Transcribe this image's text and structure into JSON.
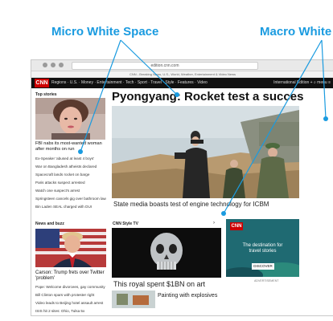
{
  "annotations": {
    "micro": "Micro White Space",
    "macro": "Macro White"
  },
  "browser": {
    "url": "edition.cnn.com",
    "tab_title": "CNN - Breaking News, U.S., World, Weather, Entertainment & Video News"
  },
  "nav": {
    "logo": "CNN",
    "links": "Regions · U.S. · Money · Entertainment · Tech · Sport · Travel · Style · Features · Video",
    "edition": "International Edition +",
    "menu": "menu"
  },
  "top_stories": {
    "label": "Top stories",
    "headline": "FBI nabs its most-wanted woman after months on run",
    "items": [
      "Ex-Speaker 'abused at least 4 boys'",
      "War on Bangladesh atheists declared",
      "Spacecraft lands rocket on barge",
      "Paris attacks suspect arrested",
      "Watch one suspect's arrest",
      "Springsteen cancels gig over bathroom law",
      "Bin Laden SEAL charged with DUI"
    ]
  },
  "main": {
    "headline": "Pyongyang: Rocket test a succes",
    "caption": "State media boasts test of engine technology for ICBM"
  },
  "news_buzz": {
    "label": "News and buzz",
    "headline_1": "Carson: Trump frets over Twitter",
    "headline_2": "'problem'",
    "items": [
      "Pope: Welcome divorcees, gay community",
      "Bill Clinton spars with protester right",
      "Video leads to Beijing hotel assault arrest",
      "ISIS hit 2 sites: Ohio, Tulsa 5x"
    ]
  },
  "style_tv": {
    "label": "CNN Style TV",
    "headline": "This royal spent $1BN on art",
    "sub": "Painting with explosives"
  },
  "ad": {
    "logo": "CNN",
    "line1": "The destination for",
    "line2": "travel stories",
    "button": "DISCOVER",
    "label": "ADVERTISEMENT"
  }
}
